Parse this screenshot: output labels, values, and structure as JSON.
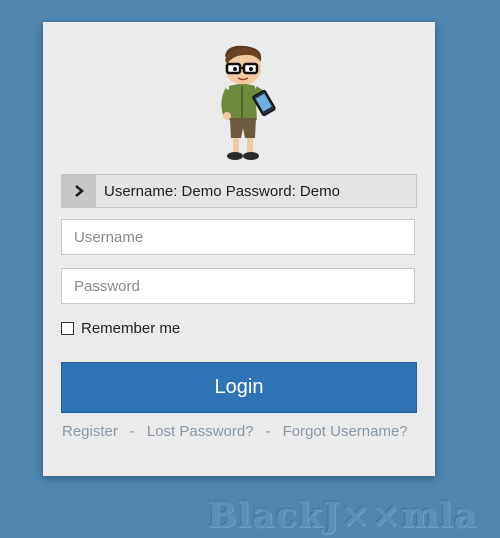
{
  "login": {
    "hint": "Username: Demo Password: Demo",
    "hint_icon": "chevron-right-icon",
    "username_placeholder": "Username",
    "password_placeholder": "Password",
    "remember_label": "Remember me",
    "login_button": "Login",
    "links": {
      "register": "Register",
      "lost_password": "Lost Password?",
      "forgot_username": "Forgot Username?",
      "separator": "-"
    }
  },
  "watermark": "BlackJ××mla",
  "colors": {
    "background": "#4f86b2",
    "panel": "#ebebeb",
    "button": "#2f74b6",
    "link": "#8a98a6"
  }
}
